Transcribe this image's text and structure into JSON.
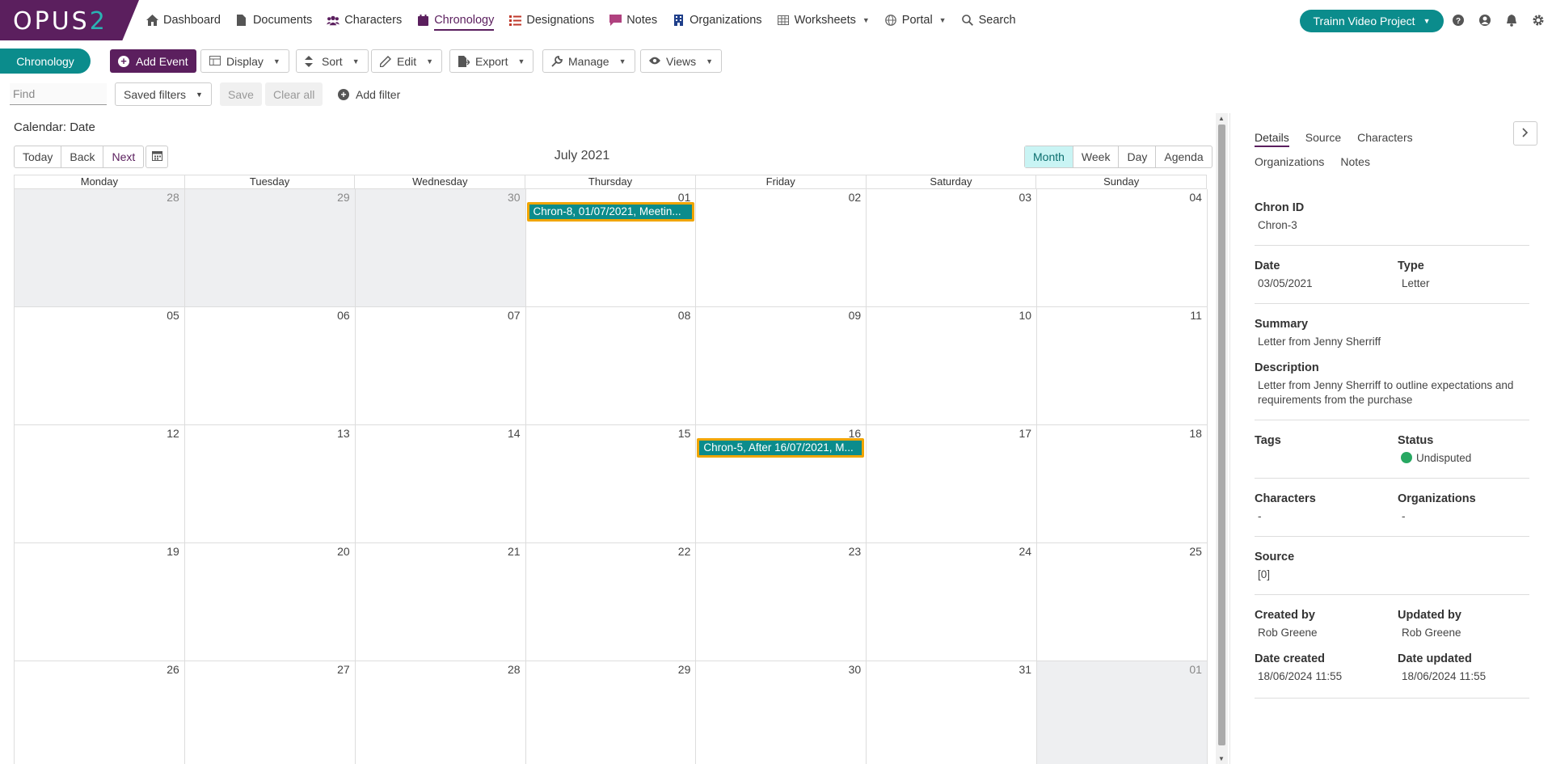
{
  "brand": {
    "logo_main": "OPUS",
    "logo_num": "2"
  },
  "nav": [
    {
      "label": "Dashboard",
      "icon": "home-icon"
    },
    {
      "label": "Documents",
      "icon": "document-icon"
    },
    {
      "label": "Characters",
      "icon": "users-icon"
    },
    {
      "label": "Chronology",
      "icon": "calendar-icon",
      "active": true
    },
    {
      "label": "Designations",
      "icon": "list-icon"
    },
    {
      "label": "Notes",
      "icon": "note-icon"
    },
    {
      "label": "Organizations",
      "icon": "building-icon"
    },
    {
      "label": "Worksheets",
      "icon": "table-icon",
      "dropdown": true
    },
    {
      "label": "Portal",
      "icon": "globe-icon",
      "dropdown": true
    },
    {
      "label": "Search",
      "icon": "search-icon"
    }
  ],
  "header": {
    "project": "Trainn Video Project"
  },
  "toolbar": {
    "section": "Chronology",
    "add_event": "Add Event",
    "display": "Display",
    "sort": "Sort",
    "edit": "Edit",
    "export": "Export",
    "manage": "Manage",
    "views": "Views"
  },
  "filters": {
    "find_placeholder": "Find",
    "saved_filters": "Saved filters",
    "save": "Save",
    "clear_all": "Clear all",
    "add_filter": "Add filter"
  },
  "calendar": {
    "title": "Calendar: Date",
    "nav": {
      "today": "Today",
      "back": "Back",
      "next": "Next"
    },
    "month_label": "July 2021",
    "views": [
      "Month",
      "Week",
      "Day",
      "Agenda"
    ],
    "active_view": "Month",
    "weekdays": [
      "Monday",
      "Tuesday",
      "Wednesday",
      "Thursday",
      "Friday",
      "Saturday",
      "Sunday"
    ],
    "weeks": [
      [
        "28",
        "29",
        "30",
        "01",
        "02",
        "03",
        "04"
      ],
      [
        "05",
        "06",
        "07",
        "08",
        "09",
        "10",
        "11"
      ],
      [
        "12",
        "13",
        "14",
        "15",
        "16",
        "17",
        "18"
      ],
      [
        "19",
        "20",
        "21",
        "22",
        "23",
        "24",
        "25"
      ],
      [
        "26",
        "27",
        "28",
        "29",
        "30",
        "31",
        "01"
      ]
    ],
    "off_days": [
      [
        0,
        0
      ],
      [
        0,
        1
      ],
      [
        0,
        2
      ],
      [
        4,
        6
      ]
    ],
    "events": [
      {
        "week": 0,
        "day": 3,
        "label": "Chron-8, 01/07/2021, Meetin..."
      },
      {
        "week": 2,
        "day": 4,
        "label": "Chron-5, After 16/07/2021, M..."
      }
    ]
  },
  "details": {
    "tabs": [
      "Details",
      "Source",
      "Characters",
      "Organizations",
      "Notes"
    ],
    "active_tab": "Details",
    "chron_id_label": "Chron ID",
    "chron_id": "Chron-3",
    "date_label": "Date",
    "date": "03/05/2021",
    "type_label": "Type",
    "type": "Letter",
    "summary_label": "Summary",
    "summary": "Letter from Jenny Sherriff",
    "description_label": "Description",
    "description": "Letter from Jenny Sherriff to outline expectations and requirements from the purchase",
    "tags_label": "Tags",
    "status_label": "Status",
    "status": "Undisputed",
    "status_color": "#27a862",
    "characters_label": "Characters",
    "characters": "-",
    "organizations_label": "Organizations",
    "organizations": "-",
    "source_label": "Source",
    "source": "[0]",
    "created_by_label": "Created by",
    "created_by": "Rob Greene",
    "updated_by_label": "Updated by",
    "updated_by": "Rob Greene",
    "date_created_label": "Date created",
    "date_created": "18/06/2024 11:55",
    "date_updated_label": "Date updated",
    "date_updated": "18/06/2024 11:55"
  },
  "colors": {
    "brand": "#5b1f5e",
    "accent": "#0b8c8c",
    "event_border": "#f0a500"
  }
}
